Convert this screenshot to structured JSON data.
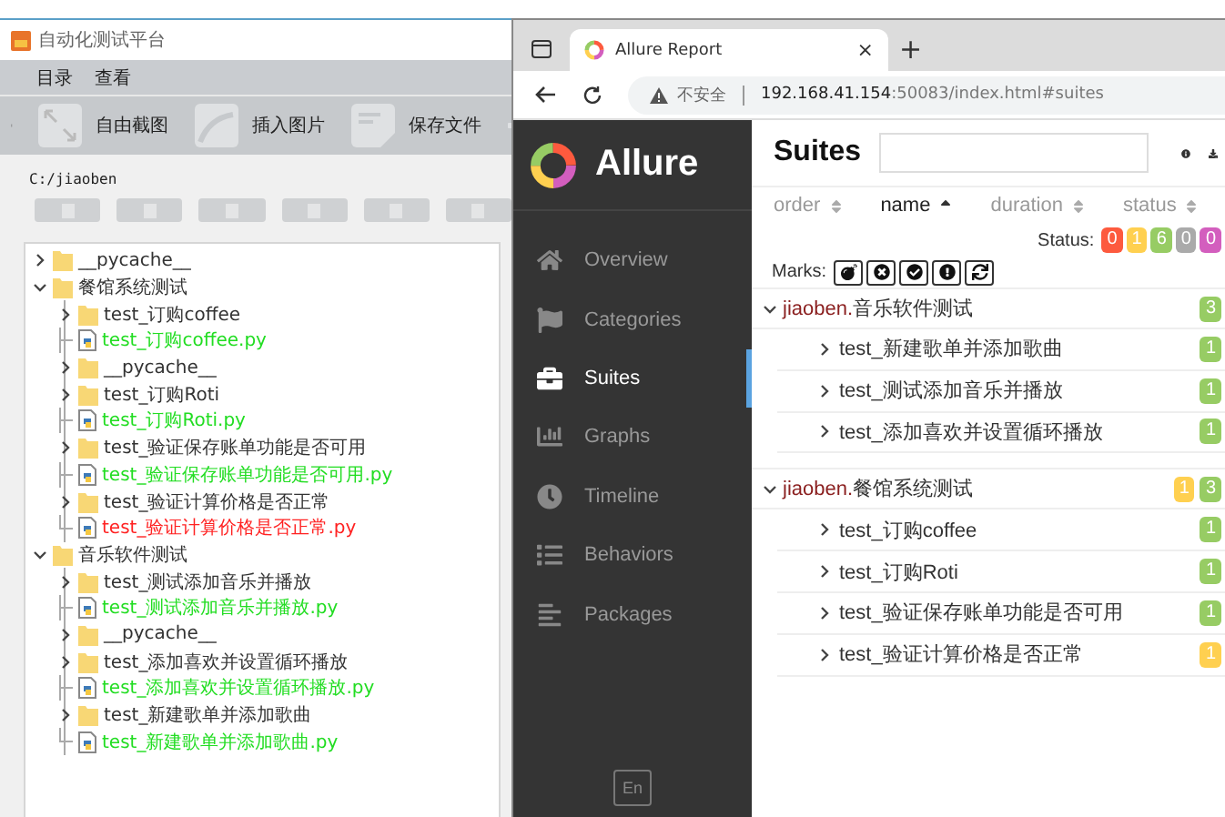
{
  "left_window": {
    "title": "自动化测试平台",
    "menu": [
      "目录",
      "查看"
    ],
    "toolbar": [
      "自由截图",
      "插入图片",
      "保存文件"
    ],
    "path": "C:/jiaoben",
    "tree": [
      {
        "kind": "folder",
        "label": "__pycache__",
        "expanded": false
      },
      {
        "kind": "folder",
        "label": "餐馆系统测试",
        "expanded": true,
        "children": [
          {
            "kind": "folder",
            "label": "test_订购coffee",
            "expanded": false
          },
          {
            "kind": "file",
            "label": "test_订购coffee.py",
            "color": "#22dd22"
          },
          {
            "kind": "folder",
            "label": "__pycache__",
            "expanded": false
          },
          {
            "kind": "folder",
            "label": "test_订购Roti",
            "expanded": false
          },
          {
            "kind": "file",
            "label": "test_订购Roti.py",
            "color": "#22dd22"
          },
          {
            "kind": "folder",
            "label": "test_验证保存账单功能是否可用",
            "expanded": false
          },
          {
            "kind": "file",
            "label": "test_验证保存账单功能是否可用.py",
            "color": "#22dd22"
          },
          {
            "kind": "folder",
            "label": "test_验证计算价格是否正常",
            "expanded": false
          },
          {
            "kind": "file",
            "label": "test_验证计算价格是否正常.py",
            "color": "#ff2222"
          }
        ]
      },
      {
        "kind": "folder",
        "label": "音乐软件测试",
        "expanded": true,
        "children": [
          {
            "kind": "folder",
            "label": "test_测试添加音乐并播放",
            "expanded": false
          },
          {
            "kind": "file",
            "label": "test_测试添加音乐并播放.py",
            "color": "#22dd22"
          },
          {
            "kind": "folder",
            "label": "__pycache__",
            "expanded": false
          },
          {
            "kind": "folder",
            "label": "test_添加喜欢并设置循环播放",
            "expanded": false
          },
          {
            "kind": "file",
            "label": "test_添加喜欢并设置循环播放.py",
            "color": "#22dd22"
          },
          {
            "kind": "folder",
            "label": "test_新建歌单并添加歌曲",
            "expanded": false
          },
          {
            "kind": "file",
            "label": "test_新建歌单并添加歌曲.py",
            "color": "#22dd22"
          }
        ]
      }
    ]
  },
  "browser": {
    "tab_title": "Allure Report",
    "tab_close": "×",
    "new_tab": "+",
    "security": "不安全",
    "url_host": "192.168.41.154",
    "url_rest": ":50083/index.html#suites",
    "brand": "Allure",
    "nav": [
      {
        "label": "Overview",
        "selected": false
      },
      {
        "label": "Categories",
        "selected": false
      },
      {
        "label": "Suites",
        "selected": true
      },
      {
        "label": "Graphs",
        "selected": false
      },
      {
        "label": "Timeline",
        "selected": false
      },
      {
        "label": "Behaviors",
        "selected": false
      },
      {
        "label": "Packages",
        "selected": false
      }
    ],
    "language": "En",
    "heading": "Suites",
    "columns": [
      {
        "label": "order",
        "selected": false
      },
      {
        "label": "name",
        "selected": true
      },
      {
        "label": "duration",
        "selected": false
      },
      {
        "label": "status",
        "selected": false
      }
    ],
    "status_label": "Status:",
    "status_counts": [
      {
        "count": "0",
        "color": "#fd5a3e"
      },
      {
        "count": "1",
        "color": "#ffd050"
      },
      {
        "count": "6",
        "color": "#97cc64"
      },
      {
        "count": "0",
        "color": "#aaaaaa"
      },
      {
        "count": "0",
        "color": "#d35ebe"
      }
    ],
    "marks_label": "Marks:",
    "suites": [
      {
        "package": "jiaoben.",
        "name": "音乐软件测试",
        "expanded": true,
        "counts": [
          {
            "count": "3",
            "color": "#97cc64"
          }
        ],
        "children": [
          {
            "name": "test_新建歌单并添加歌曲",
            "counts": [
              {
                "count": "1",
                "color": "#97cc64"
              }
            ]
          },
          {
            "name": "test_测试添加音乐并播放",
            "counts": [
              {
                "count": "1",
                "color": "#97cc64"
              }
            ]
          },
          {
            "name": "test_添加喜欢并设置循环播放",
            "counts": [
              {
                "count": "1",
                "color": "#97cc64"
              }
            ]
          }
        ]
      },
      {
        "package": "jiaoben.",
        "name": "餐馆系统测试",
        "expanded": true,
        "counts": [
          {
            "count": "1",
            "color": "#ffd050"
          },
          {
            "count": "3",
            "color": "#97cc64"
          }
        ],
        "children": [
          {
            "name": "test_订购coffee",
            "counts": [
              {
                "count": "1",
                "color": "#97cc64"
              }
            ]
          },
          {
            "name": "test_订购Roti",
            "counts": [
              {
                "count": "1",
                "color": "#97cc64"
              }
            ]
          },
          {
            "name": "test_验证保存账单功能是否可用",
            "counts": [
              {
                "count": "1",
                "color": "#97cc64"
              }
            ]
          },
          {
            "name": "test_验证计算价格是否正常",
            "counts": [
              {
                "count": "1",
                "color": "#ffd050"
              }
            ]
          }
        ]
      }
    ]
  }
}
